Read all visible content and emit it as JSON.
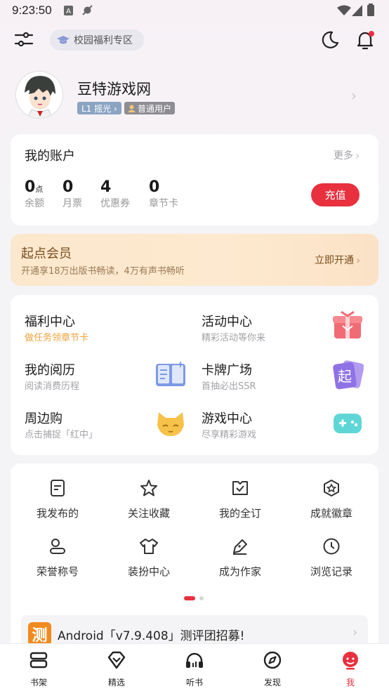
{
  "status_bar": {
    "time": "9:23:50"
  },
  "top_bar": {
    "campus_label": "校园福利专区"
  },
  "profile": {
    "username": "豆特游戏网",
    "level_badge": "L1 摇光 ›",
    "user_type": "普通用户"
  },
  "account": {
    "title": "我的账户",
    "more": "更多",
    "stats": [
      {
        "value": "0",
        "unit": "点",
        "label": "余额"
      },
      {
        "value": "0",
        "unit": "",
        "label": "月票"
      },
      {
        "value": "4",
        "unit": "",
        "label": "优惠券"
      },
      {
        "value": "0",
        "unit": "",
        "label": "章节卡"
      }
    ],
    "recharge": "充值"
  },
  "member": {
    "title": "起点会员",
    "subtitle": "开通享18万出版书畅读，4万有声书畅听",
    "action": "立即开通"
  },
  "features": [
    {
      "title": "福利中心",
      "subtitle": "做任务领章节卡",
      "icon": "gift-box-icon"
    },
    {
      "title": "活动中心",
      "subtitle": "精彩活动等你来",
      "icon": "gift-box-icon"
    },
    {
      "title": "我的阅历",
      "subtitle": "阅读消费历程",
      "icon": "book-icon"
    },
    {
      "title": "卡牌广场",
      "subtitle": "首抽必出SSR",
      "icon": "card-icon"
    },
    {
      "title": "周边购",
      "subtitle": "点击捕捉「红中」",
      "icon": "fox-icon"
    },
    {
      "title": "游戏中心",
      "subtitle": "尽享精彩游戏",
      "icon": "gamepad-icon"
    }
  ],
  "card_badge_char": "起",
  "grid": [
    {
      "label": "我发布的",
      "icon": "document-icon"
    },
    {
      "label": "关注收藏",
      "icon": "star-icon"
    },
    {
      "label": "我的全订",
      "icon": "checked-box-icon"
    },
    {
      "label": "成就徽章",
      "icon": "badge-icon"
    },
    {
      "label": "荣誉称号",
      "icon": "user-title-icon"
    },
    {
      "label": "装扮中心",
      "icon": "shirt-icon"
    },
    {
      "label": "成为作家",
      "icon": "pen-icon"
    },
    {
      "label": "浏览记录",
      "icon": "clock-icon"
    }
  ],
  "banner": {
    "icon_char": "测",
    "text": "Android「v7.9.408」测评团招募!"
  },
  "bottom_nav": [
    {
      "label": "书架",
      "icon": "bookshelf-icon"
    },
    {
      "label": "精选",
      "icon": "diamond-icon"
    },
    {
      "label": "听书",
      "icon": "headphones-icon"
    },
    {
      "label": "发现",
      "icon": "compass-icon"
    },
    {
      "label": "我",
      "icon": "me-icon",
      "active": true
    }
  ],
  "colors": {
    "accent": "#e8303f",
    "member_gold": "#7a4d1c",
    "welfare_orange": "#f0a23c"
  }
}
